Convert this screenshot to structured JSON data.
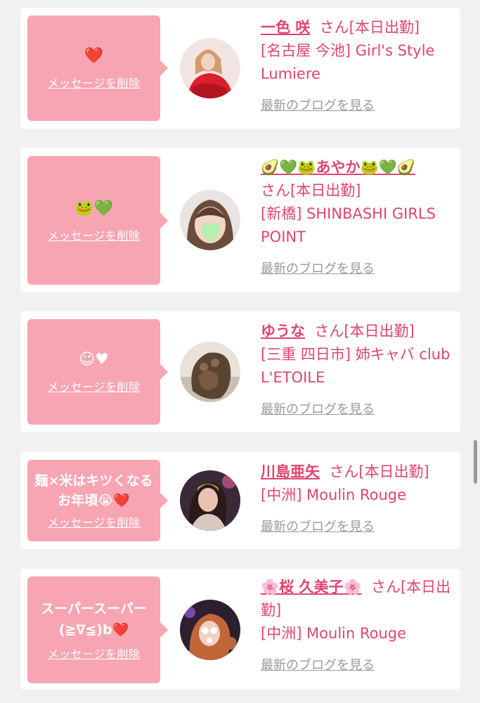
{
  "entries": [
    {
      "message": "❤️",
      "delete_label": "メッセージを削除",
      "name": "一色 咲",
      "status": "さん[本日出勤]",
      "shop": "[名古屋 今池] Girl's Style Lumiere",
      "blog_label": "最新のブログを見る"
    },
    {
      "message": "🐸💚",
      "delete_label": "メッセージを削除",
      "name": "🥑💚🐸あやか🐸💚🥑",
      "status": "さん[本日出勤]",
      "shop": "[新橋] SHINBASHI GIRLS POINT",
      "blog_label": "最新のブログを見る"
    },
    {
      "message": "☺︎♥",
      "delete_label": "メッセージを削除",
      "name": "ゆうな",
      "status": "さん[本日出勤]",
      "shop": "[三重 四日市] 姉キャバ club L'ETOILE",
      "blog_label": "最新のブログを見る"
    },
    {
      "message": "麺×米はキツくなるお年頃😭❤️",
      "delete_label": "メッセージを削除",
      "name": "川島亜矢",
      "status": "さん[本日出勤]",
      "shop": "[中洲] Moulin Rouge",
      "blog_label": "最新のブログを見る"
    },
    {
      "message": "スーパースーパー(≧∇≦)b❤️",
      "delete_label": "メッセージを削除",
      "name": "🌸桜 久美子🌸",
      "status": "さん[本日出勤]",
      "shop": "[中洲] Moulin Rouge",
      "blog_label": "最新のブログを見る"
    }
  ],
  "colors": {
    "bubble": "#f8a5b3",
    "accent_text": "#e1456e",
    "blog_link": "#9a9a9a",
    "page_bg": "#f1f1f1"
  }
}
